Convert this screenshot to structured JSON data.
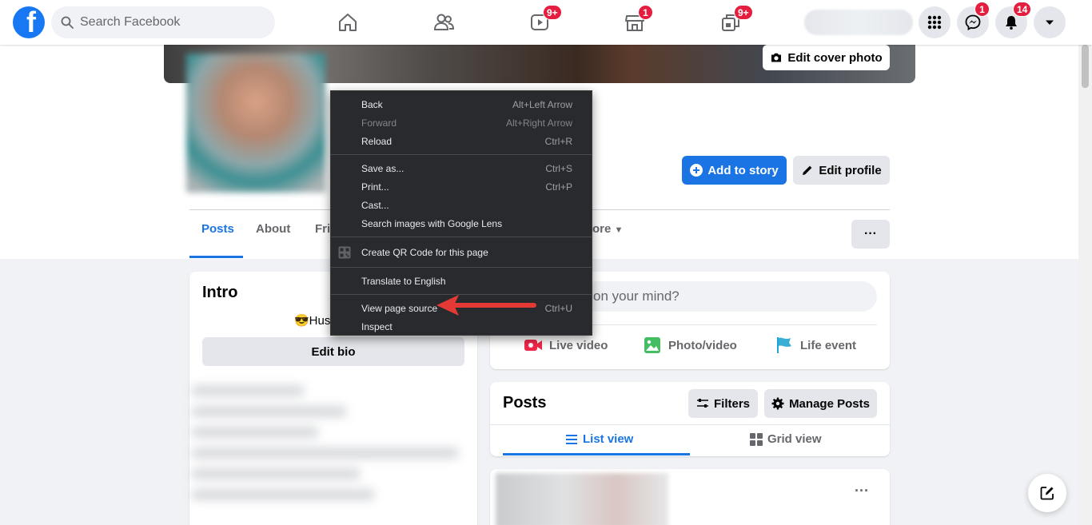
{
  "nav": {
    "search_placeholder": "Search Facebook",
    "badges": {
      "watch": "9+",
      "marketplace": "1",
      "groups": "9+",
      "messenger": "1",
      "notifications": "14"
    }
  },
  "profile": {
    "edit_cover_label": "Edit cover photo",
    "add_story_label": "Add to story",
    "edit_profile_label": "Edit profile",
    "more_dots": "···"
  },
  "tabs": {
    "posts": "Posts",
    "about": "About",
    "friends_partial": "Fri",
    "more_partial": "ore"
  },
  "intro": {
    "title": "Intro",
    "bio_partial": "😎Hus",
    "edit_bio_label": "Edit bio"
  },
  "composer": {
    "placeholder_partial": "on your mind?",
    "live_video": "Live video",
    "photo_video": "Photo/video",
    "life_event": "Life event"
  },
  "posts_section": {
    "title": "Posts",
    "filters_label": "Filters",
    "manage_label": "Manage Posts",
    "list_view": "List view",
    "grid_view": "Grid view",
    "post_dots": "···"
  },
  "context_menu": {
    "back": "Back",
    "back_sc": "Alt+Left Arrow",
    "forward": "Forward",
    "forward_sc": "Alt+Right Arrow",
    "reload": "Reload",
    "reload_sc": "Ctrl+R",
    "save_as": "Save as...",
    "save_as_sc": "Ctrl+S",
    "print": "Print...",
    "print_sc": "Ctrl+P",
    "cast": "Cast...",
    "lens": "Search images with Google Lens",
    "qr": "Create QR Code for this page",
    "translate": "Translate to English",
    "view_source": "View page source",
    "view_source_sc": "Ctrl+U",
    "inspect": "Inspect"
  },
  "colors": {
    "brand": "#1877f2",
    "badge": "#e41e3f",
    "annotation_arrow": "#e53935"
  }
}
